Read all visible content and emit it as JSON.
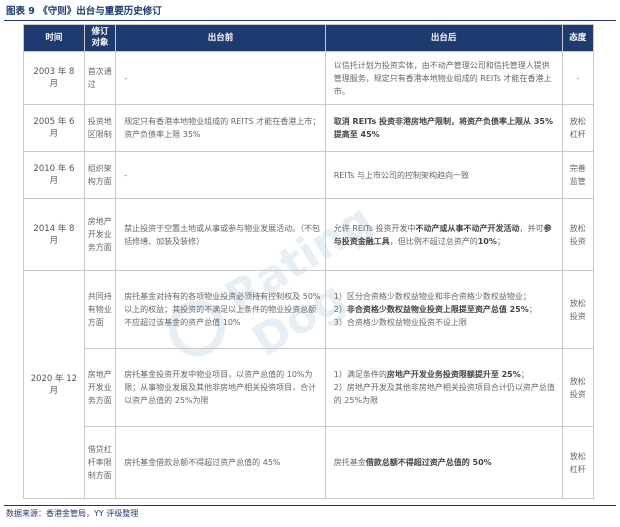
{
  "title": "图表 9 《守则》出台与重要历史修订",
  "headers": {
    "time": "时间",
    "type": "修订对象",
    "before": "出台前",
    "after": "出台后",
    "attitude": "态度"
  },
  "rows": [
    {
      "time": "2003 年 8 月",
      "type": "首次通过",
      "before": "-",
      "after": "以信托计划为投资实体，由不动产管理公司和信托管理人提供管理服务，规定只有香港本地物业组成的 REITs 才能在香港上市。",
      "attitude": "-"
    },
    {
      "time": "2005 年 6 月",
      "type": "投资地区限制",
      "before": "规定只有香港本地物业组成的 REITS 才能在香港上市；资产负债率上限 35%",
      "after": "取消 REITs 投资非港房地产限制，将资产负债率上限从 35%提高至 45%",
      "attitude": "放松杠杆"
    },
    {
      "time": "2010 年 6 月",
      "type": "组织架构方面",
      "before": "-",
      "after": "REITs 与上市公司的控制架构趋向一致",
      "attitude": "完善监管"
    },
    {
      "time": "2014 年 8 月",
      "type": "房地产开发业务方面",
      "before": "禁止投资于空置土地或从事或参与物业发展活动。（不包括修缮、加装及装修）",
      "after_p1": "允许 REITs 投资开发中",
      "after_b1": "不动产或从事不动产开发活动",
      "after_p2": "，并可",
      "after_b2": "参与投资金融工具",
      "after_p3": "，但比例不超过总资产的",
      "after_b3": "10%",
      "after_p4": "；",
      "attitude": "放松投资"
    },
    {
      "time": "2020 年 12 月",
      "type": "共同持有物业方面",
      "before": "房托基金对持有的各项物业投资必须持有控制权及 50%以上的权益；其投资的不满足以上条件的物业投资总额不应超过该基金的资产总值 10%",
      "after_l1": "1）区分合资格少数权益物业和非合资格少数权益物业；",
      "after_l2a": "2）",
      "after_l2b": "非合资格少数权益物业投资上限提至资产总值 25%",
      "after_l2c": "；",
      "after_l3": "3）合资格少数权益物业投资不设上限",
      "attitude": "放松投资"
    },
    {
      "type": "房地产开发业务方面",
      "before": "房托基金投资开发中物业项目，以资产总值的 10%为限；从事物业发展及其他非房地产相关投资项目，合计以资产总值的 25%为限",
      "after_l1a": "1）满足条件的",
      "after_l1b": "房地产开发业务投资限额提升至 25%",
      "after_l1c": "；",
      "after_l2": "2）房地产开发及其他非房地产相关投资项目合计仍以资产总值的 25%为限",
      "attitude": "放松投资"
    },
    {
      "type": "借贷杠杆率限制方面",
      "before": "房托基金借款总额不得超过资产总值的 45%",
      "after_p1": "房托基金",
      "after_b1": "借款总额不得超过资产总值的 50%",
      "attitude": "放松杠杆"
    }
  ],
  "source": "数据来源：香港金管局，YY 评级整理"
}
